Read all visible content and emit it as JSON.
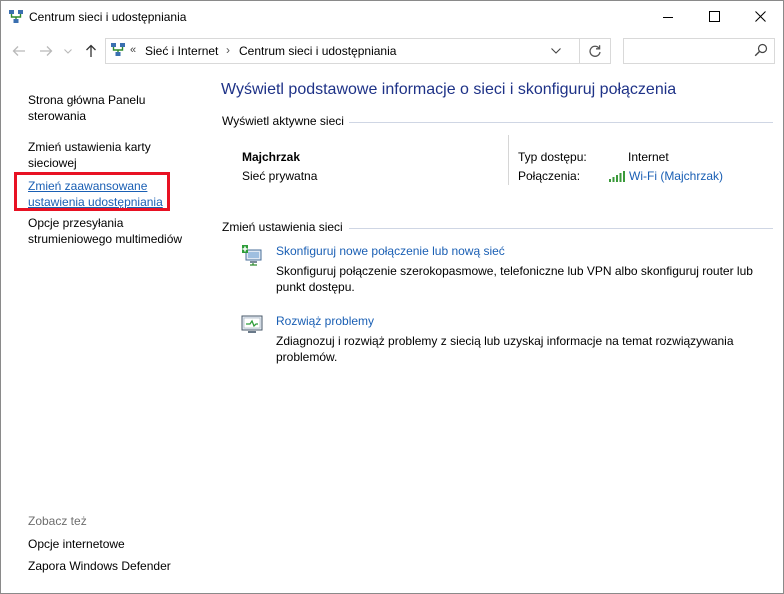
{
  "window": {
    "title": "Centrum sieci i udostępniania"
  },
  "address": {
    "chevron": "«",
    "crumbs": [
      "Sieć i Internet",
      "Centrum sieci i udostępniania"
    ],
    "separator": "›",
    "search_placeholder": ""
  },
  "left_panel": {
    "home_link": "Strona główna Panelu sterowania",
    "adapter_link": "Zmień ustawienia karty sieciowej",
    "advanced_link": "Zmień zaawansowane ustawienia udostępniania",
    "media_link": "Opcje przesyłania strumieniowego multimediów",
    "see_also": "Zobacz też",
    "internet_options": "Opcje internetowe",
    "firewall": "Zapora Windows Defender"
  },
  "main": {
    "title": "Wyświetl podstawowe informacje o sieci i skonfiguruj połączenia",
    "active_networks_header": "Wyświetl aktywne sieci",
    "network_name": "Majchrzak",
    "network_type": "Sieć prywatna",
    "access_type_label": "Typ dostępu:",
    "access_type_value": "Internet",
    "connections_label": "Połączenia:",
    "connection_value": "Wi-Fi (Majchrzak)",
    "change_settings_header": "Zmień ustawienia sieci",
    "tasks": [
      {
        "link": "Skonfiguruj nowe połączenie lub nową sieć",
        "desc": "Skonfiguruj połączenie szerokopasmowe, telefoniczne lub VPN albo skonfiguruj router lub punkt dostępu."
      },
      {
        "link": "Rozwiąż problemy",
        "desc": "Zdiagnozuj i rozwiąż problemy z siecią lub uzyskaj informacje na temat rozwiązywania problemów."
      }
    ]
  },
  "colors": {
    "link": "#1a5fb4",
    "title": "#1e3287",
    "highlight": "#e81123",
    "wifi": "#3a9a3a"
  }
}
